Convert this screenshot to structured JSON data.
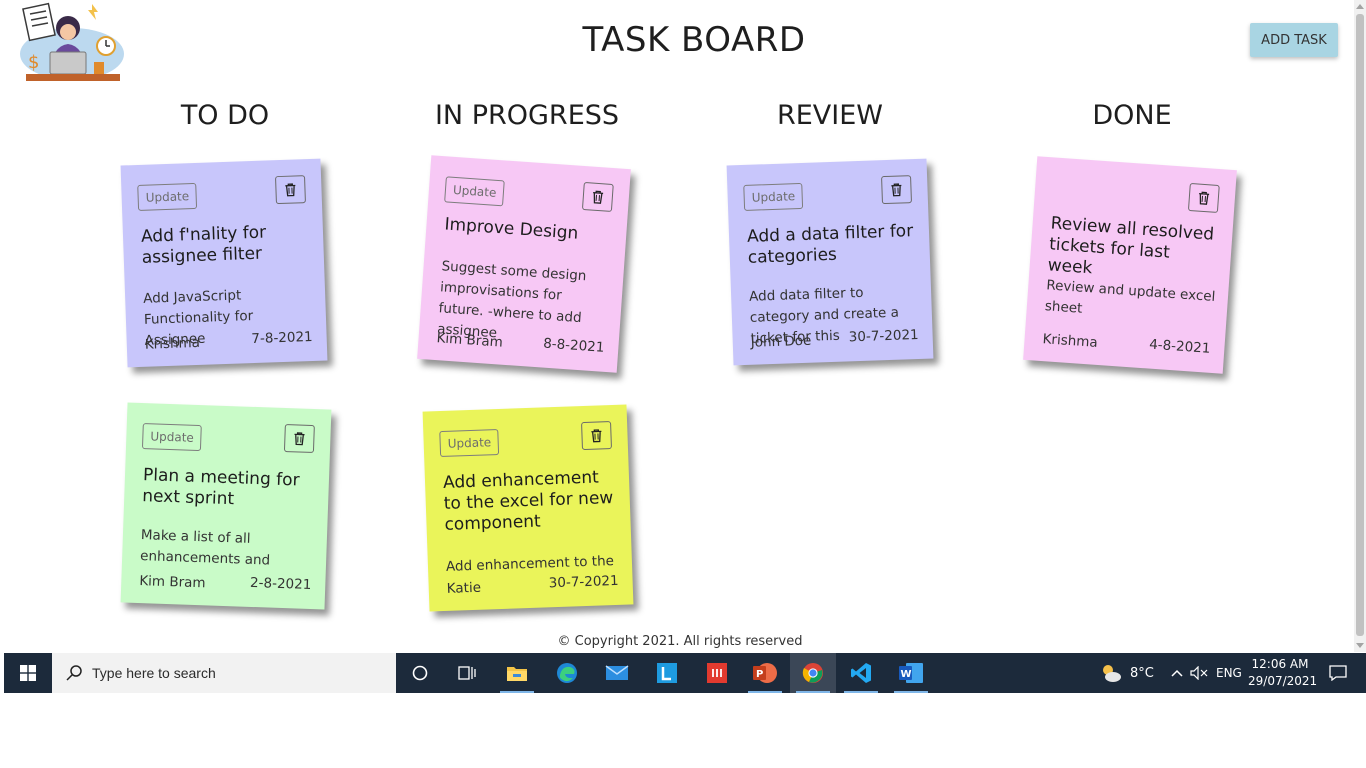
{
  "header": {
    "title": "TASK BOARD",
    "add_task_label": "ADD TASK"
  },
  "columns": [
    "TO DO",
    "IN PROGRESS",
    "REVIEW",
    "DONE"
  ],
  "notes": [
    {
      "column": "TO DO",
      "color": "#c8c6fb",
      "update_label": "Update",
      "title": "Add f'nality for assignee filter",
      "description": "Add JavaScript Functionality for Assignee",
      "assignee": "Krishma",
      "date": "7-8-2021"
    },
    {
      "column": "TO DO",
      "color": "#c9fbc8",
      "update_label": "Update",
      "title": "Plan a meeting for next sprint",
      "description": "Make a list of all enhancements and",
      "assignee": "Kim Bram",
      "date": "2-8-2021"
    },
    {
      "column": "IN PROGRESS",
      "color": "#f7c8f5",
      "update_label": "Update",
      "title": "Improve Design",
      "description": "Suggest some design improvisations for future. -where to add assignee",
      "assignee": "Kim Bram",
      "date": "8-8-2021"
    },
    {
      "column": "IN PROGRESS",
      "color": "#eaf45a",
      "update_label": "Update",
      "title": "Add enhancement to the excel for new component",
      "description": "Add enhancement to the",
      "assignee": "Katie",
      "date": "30-7-2021"
    },
    {
      "column": "REVIEW",
      "color": "#c8c6fb",
      "update_label": "Update",
      "title": "Add a data filter for categories",
      "description": "Add data filter to category and create a ticket for this",
      "assignee": "John Doe",
      "date": "30-7-2021"
    },
    {
      "column": "DONE",
      "color": "#f7c8f5",
      "update_label": "",
      "title": "Review all resolved tickets for last week",
      "description": "Review and update excel sheet",
      "assignee": "Krishma",
      "date": "4-8-2021"
    }
  ],
  "footer": {
    "text": "© Copyright 2021. All rights reserved"
  },
  "taskbar": {
    "search_placeholder": "Type here to search",
    "apps": [
      "task-view",
      "file-explorer",
      "edge",
      "mail",
      "app-l",
      "app-red",
      "powerpoint",
      "chrome",
      "vscode",
      "word"
    ],
    "weather": "8°C",
    "language": "ENG",
    "time": "12:06 AM",
    "date": "29/07/2021"
  }
}
